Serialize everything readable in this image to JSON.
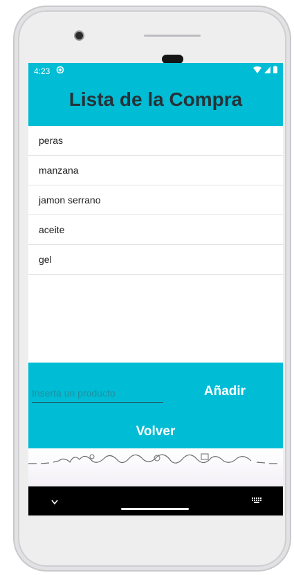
{
  "status_bar": {
    "time": "4:23"
  },
  "app": {
    "title": "Lista de la Compra"
  },
  "list": {
    "items": [
      {
        "label": "peras"
      },
      {
        "label": "manzana"
      },
      {
        "label": "jamon serrano"
      },
      {
        "label": "aceite"
      },
      {
        "label": "gel"
      }
    ]
  },
  "form": {
    "input_value": "",
    "input_placeholder": "Inserta un producto",
    "add_label": "Añadir",
    "back_label": "Volver"
  },
  "colors": {
    "accent": "#00bcd4",
    "title_text": "#263238"
  }
}
